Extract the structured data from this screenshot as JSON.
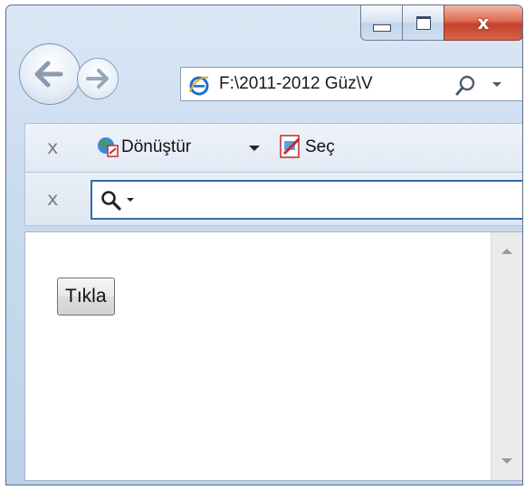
{
  "window": {
    "caption_buttons": {
      "minimize": "minimize",
      "maximize": "maximize",
      "close": "x"
    },
    "accent_close": "#c4402a"
  },
  "nav": {
    "back_icon": "back-arrow-icon",
    "forward_icon": "forward-arrow-icon",
    "address": "F:\\2011-2012 Güz\\V",
    "address_icon": "internet-explorer-icon",
    "search_icon": "magnifier-icon"
  },
  "toolbar1": {
    "close_label": "x",
    "convert_label": "Dönüştür",
    "select_label": "Seç"
  },
  "toolbar2": {
    "close_label": "x",
    "search_icon": "magnifier-icon"
  },
  "page": {
    "button_label": "Tıkla"
  }
}
